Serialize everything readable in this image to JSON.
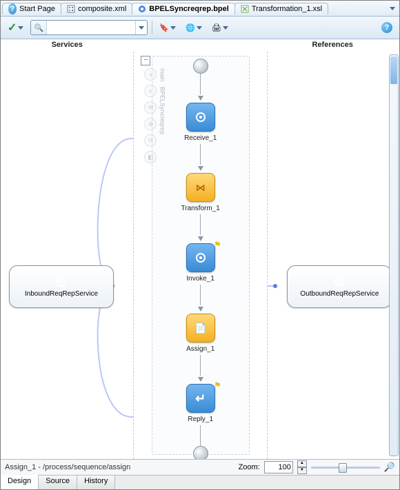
{
  "tabs": {
    "start": "Start Page",
    "composite": "composite.xml",
    "bpel": "BPELSyncreqrep.bpel",
    "xsl": "Transformation_1.xsl"
  },
  "headers": {
    "services": "Services",
    "references": "References"
  },
  "ghost": {
    "main_label": "main",
    "process_label": "BPELSyncreqrep"
  },
  "flow": {
    "receive": "Receive_1",
    "transform": "Transform_1",
    "invoke": "Invoke_1",
    "assign": "Assign_1",
    "reply": "Reply_1"
  },
  "partners": {
    "inbound": "InboundReqRepService",
    "outbound": "OutboundReqRepService"
  },
  "status": {
    "selection": "Assign_1 - /process/sequence/assign",
    "zoom_label": "Zoom:",
    "zoom_value": "100"
  },
  "bottom_tabs": {
    "design": "Design",
    "source": "Source",
    "history": "History"
  },
  "glyphs": {
    "help": "?",
    "check": "✓",
    "bookmark": "🔖",
    "globe": "🌐",
    "print": "🖨",
    "bino": "🔍",
    "flag": "⚑",
    "xfer": "⋈",
    "assign": "📄",
    "reply": "↵",
    "mag": "🔎",
    "minus": "−"
  }
}
